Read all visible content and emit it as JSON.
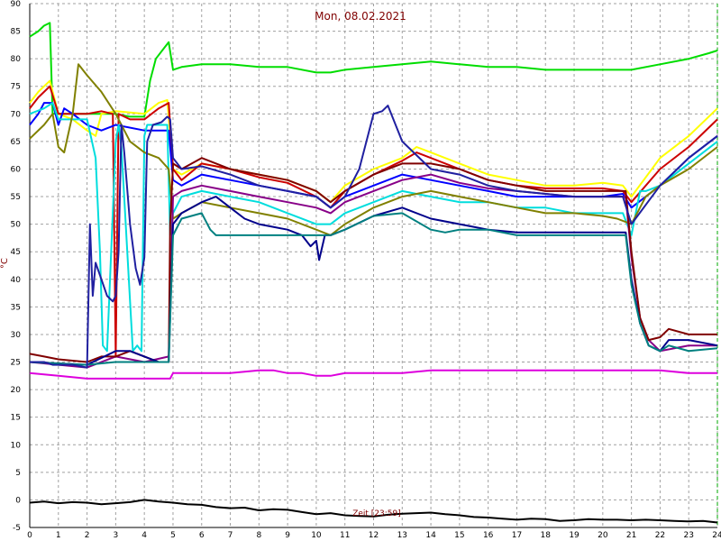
{
  "chart_data": {
    "type": "line",
    "title": "Mon, 08.02.2021",
    "xlabel": "Zeit [23:59]",
    "ylabel": "°C",
    "xlim": [
      0,
      24
    ],
    "ylim": [
      -5,
      90
    ],
    "x_ticks": [
      "0",
      "1",
      "2",
      "3",
      "4",
      "5",
      "6",
      "7",
      "8",
      "9",
      "10",
      "11",
      "12",
      "13",
      "14",
      "15",
      "16",
      "17",
      "18",
      "19",
      "20",
      "21",
      "22",
      "23",
      "24"
    ],
    "y_ticks": [
      "-5",
      "0",
      "5",
      "10",
      "15",
      "20",
      "25",
      "30",
      "35",
      "40",
      "45",
      "50",
      "55",
      "60",
      "65",
      "70",
      "75",
      "80",
      "85",
      "90"
    ],
    "grid": true,
    "series": [
      {
        "color": "#00dd00",
        "x": [
          0,
          0.3,
          0.5,
          0.7,
          0.8,
          1.0,
          1.3,
          1.5,
          2,
          2.5,
          3,
          3.5,
          4,
          4.2,
          4.4,
          4.7,
          4.85,
          5.0,
          5.3,
          6,
          7,
          8,
          9,
          10,
          10.5,
          11,
          12,
          13,
          14,
          15,
          16,
          17,
          18,
          19,
          20,
          21,
          22,
          23,
          23.7,
          24
        ],
        "y": [
          84,
          85,
          86,
          86.5,
          70,
          70,
          70,
          70,
          70,
          70,
          70,
          69.5,
          69.5,
          76,
          80,
          82,
          83,
          78,
          78.5,
          79,
          79,
          78.5,
          78.5,
          77.5,
          77.5,
          78,
          78.5,
          79,
          79.5,
          79,
          78.5,
          78.5,
          78,
          78,
          78,
          78,
          79,
          80,
          81,
          81.5
        ]
      },
      {
        "color": "#ffff00",
        "x": [
          0,
          0.3,
          0.5,
          0.7,
          1.0,
          1.5,
          2,
          2.3,
          2.5,
          3,
          4,
          4.5,
          4.8,
          5,
          5.3,
          6,
          7,
          8,
          9,
          10,
          10.5,
          11,
          12,
          13,
          13.5,
          14,
          15,
          16,
          17,
          18,
          19,
          20,
          20.7,
          21,
          22,
          23,
          24
        ],
        "y": [
          72,
          74,
          75,
          76,
          70,
          69,
          67,
          66,
          70,
          70.5,
          70,
          72,
          72.5,
          60,
          59,
          61,
          60,
          59,
          58,
          56,
          54,
          57,
          60,
          62,
          64,
          63,
          61,
          59,
          58,
          57,
          57,
          57.5,
          57,
          55,
          62,
          66,
          71
        ]
      },
      {
        "color": "#cc0000",
        "x": [
          0,
          0.3,
          0.5,
          0.7,
          1,
          2,
          2.5,
          2.9,
          3,
          3.1,
          3.5,
          4,
          4.5,
          4.85,
          5,
          5.3,
          6,
          7,
          8,
          9,
          10,
          10.5,
          11,
          12,
          13,
          13.5,
          14,
          15,
          16,
          17,
          18,
          19,
          20,
          20.7,
          21,
          22,
          23,
          24
        ],
        "y": [
          71,
          73,
          74,
          75,
          70,
          70,
          70.5,
          70,
          26,
          70,
          69,
          69,
          71,
          72,
          60,
          58,
          61,
          60,
          58.5,
          57.5,
          55,
          53,
          56,
          59,
          61.5,
          63,
          62,
          60,
          58,
          57,
          56.5,
          56.5,
          56.5,
          56,
          54,
          60,
          64,
          69
        ]
      },
      {
        "color": "#0000ff",
        "x": [
          0,
          0.3,
          0.5,
          0.8,
          1.0,
          1.2,
          1.5,
          2,
          2.5,
          3,
          4,
          4.5,
          4.85,
          5,
          5.3,
          6,
          7,
          8,
          9,
          10,
          10.5,
          11,
          12,
          13,
          14,
          15,
          16,
          17,
          18,
          19,
          20,
          20.7,
          21,
          22,
          23,
          24
        ],
        "y": [
          68,
          70,
          72,
          72,
          68,
          71,
          70,
          68,
          67,
          68,
          67,
          67,
          67,
          58,
          57,
          59,
          58,
          57,
          56,
          55,
          53,
          55,
          57,
          59,
          58,
          57,
          56,
          55,
          55,
          55,
          55,
          55.5,
          53,
          57,
          62,
          66
        ]
      },
      {
        "color": "#00dddd",
        "x": [
          0,
          0.5,
          0.8,
          1,
          1.5,
          2,
          2.3,
          2.45,
          2.55,
          2.7,
          3.0,
          3.1,
          3.2,
          3.6,
          3.75,
          3.9,
          4.0,
          4.1,
          4.3,
          4.8,
          4.9,
          5.0,
          5.3,
          6,
          7,
          8,
          9,
          10,
          10.5,
          11,
          12,
          13,
          14,
          15,
          16,
          17,
          18,
          19,
          20,
          20.7,
          21,
          21.3,
          21.5,
          22,
          23,
          24
        ],
        "y": [
          70,
          71,
          72,
          69,
          69,
          69,
          62,
          45,
          28,
          27,
          65,
          68,
          64,
          27,
          28,
          27,
          66,
          68,
          68,
          68,
          48,
          52,
          55,
          56,
          55,
          54,
          52,
          50,
          50,
          52,
          54,
          56,
          55,
          54,
          54,
          53,
          53,
          52,
          52,
          52,
          48,
          56,
          56,
          57,
          61,
          65
        ]
      },
      {
        "color": "#808000",
        "x": [
          0,
          0.5,
          0.8,
          1,
          1.2,
          1.5,
          1.7,
          2,
          2.5,
          3,
          3.5,
          4,
          4.5,
          4.85,
          5,
          5.3,
          6,
          7,
          8,
          9,
          10,
          10.5,
          11,
          12,
          13,
          14,
          15,
          16,
          17,
          18,
          19,
          20,
          20.5,
          21,
          21.5,
          22,
          23,
          24
        ],
        "y": [
          65.5,
          68,
          70,
          64,
          63,
          70,
          79,
          77,
          74,
          70,
          65,
          63,
          62,
          60,
          51,
          52,
          54,
          53,
          52,
          51,
          49,
          48,
          50,
          53,
          55,
          56,
          55,
          54,
          53,
          52,
          52,
          51.5,
          51,
          50,
          55,
          57,
          60,
          64
        ]
      },
      {
        "color": "#880088",
        "x": [
          0,
          2,
          3,
          4,
          4.85,
          5,
          5.3,
          6,
          7,
          8,
          9,
          10,
          10.5,
          11,
          12,
          13,
          14,
          15,
          16,
          17,
          18,
          19,
          20,
          20.8,
          21,
          21.3,
          21.6,
          22,
          23,
          24
        ],
        "y": [
          25,
          24,
          26,
          25,
          26,
          55,
          56,
          57,
          56,
          55,
          54,
          53,
          52,
          54,
          56,
          58,
          59,
          57.5,
          56.5,
          56,
          55.5,
          55,
          55,
          55,
          44,
          33,
          29,
          27,
          28,
          28
        ]
      },
      {
        "color": "#800000",
        "x": [
          0,
          0.5,
          1,
          2,
          2.5,
          3,
          3.5,
          4,
          4.5,
          4.85,
          4.9,
          5.0,
          5.3,
          6,
          7,
          8,
          9,
          10,
          10.5,
          11,
          12,
          13,
          14,
          15,
          16,
          17,
          18,
          19,
          20,
          20.8,
          21,
          21.3,
          21.6,
          22,
          22.3,
          23,
          24
        ],
        "y": [
          26.5,
          26,
          25.5,
          25,
          26,
          26,
          27,
          26,
          25,
          25,
          50,
          61,
          60,
          62,
          60,
          59,
          58,
          56,
          54,
          56,
          59,
          61,
          61,
          60,
          58,
          57,
          56,
          56,
          56,
          56,
          45,
          33,
          29,
          29.5,
          31,
          30,
          30
        ]
      },
      {
        "color": "#00008b",
        "x": [
          0,
          2,
          3,
          3.5,
          4,
          4.5,
          4.85,
          5,
          5.3,
          6,
          6.5,
          7,
          7.5,
          8,
          9,
          9.5,
          9.8,
          10,
          10.1,
          10.3,
          10.5,
          11,
          12,
          13,
          14,
          15,
          16,
          17,
          18,
          19,
          20,
          20.8,
          21,
          21.3,
          21.6,
          22,
          22.3,
          23,
          24
        ],
        "y": [
          25,
          24.5,
          27,
          27,
          26,
          25,
          25,
          50,
          52,
          54,
          55,
          53,
          51,
          50,
          49,
          48,
          46,
          47,
          43.5,
          48,
          48,
          49,
          51.5,
          53,
          51,
          50,
          49,
          48.5,
          48.5,
          48.5,
          48.5,
          48.5,
          40,
          32,
          28,
          27,
          29,
          29,
          28
        ]
      },
      {
        "color": "#008080",
        "x": [
          0,
          2,
          3,
          4,
          4.85,
          5,
          5.3,
          6,
          6.3,
          6.5,
          7,
          8,
          9,
          10,
          10.5,
          11,
          12,
          13,
          14,
          14.5,
          15,
          16,
          17,
          18,
          19,
          20,
          20.8,
          21,
          21.3,
          21.6,
          22,
          22.3,
          23,
          24
        ],
        "y": [
          25,
          24.5,
          25,
          25,
          25,
          48,
          51,
          52,
          49,
          48,
          48,
          48,
          48,
          48,
          48,
          49,
          51.5,
          52,
          49,
          48.5,
          49,
          49,
          48,
          48,
          48,
          48,
          48,
          39,
          32,
          28,
          27,
          28,
          27,
          27.5
        ]
      },
      {
        "color": "#2020a0",
        "x": [
          0,
          0.5,
          0.8,
          1.0,
          1.2,
          1.5,
          2,
          2.1,
          2.2,
          2.3,
          2.5,
          2.7,
          2.9,
          3,
          3.1,
          3.2,
          3.3,
          3.5,
          3.7,
          3.85,
          4.0,
          4.1,
          4.3,
          4.6,
          4.8,
          4.9,
          5.0,
          5.3,
          6,
          7,
          8,
          9,
          10,
          10.5,
          11,
          11.5,
          12,
          12.3,
          12.5,
          13,
          14,
          15,
          16,
          17,
          18,
          19,
          20,
          20.7,
          21,
          22,
          23,
          24
        ],
        "y": [
          25,
          25,
          24.5,
          24.5,
          24.5,
          24.5,
          24,
          50,
          37,
          43,
          40,
          37,
          36,
          37,
          45,
          68,
          63,
          50,
          42,
          39,
          44,
          65,
          68,
          68.5,
          69.5,
          69,
          62,
          60,
          60.5,
          59,
          57,
          56,
          55,
          53,
          55,
          60,
          70,
          70.5,
          71.5,
          65,
          60,
          59,
          57,
          56,
          55.5,
          55,
          55,
          55,
          50,
          57,
          62,
          66
        ]
      },
      {
        "color": "#dd00dd",
        "x": [
          0,
          1,
          2,
          3,
          4,
          4.9,
          5.0,
          6,
          7,
          8,
          8.5,
          9,
          9.5,
          10,
          10.5,
          11,
          12,
          13,
          14,
          15,
          16,
          17,
          18,
          19,
          20,
          21,
          22,
          23,
          24
        ],
        "y": [
          23,
          22.5,
          22,
          22,
          22,
          22,
          23,
          23,
          23,
          23.5,
          23.5,
          23,
          23,
          22.5,
          22.5,
          23,
          23,
          23,
          23.5,
          23.5,
          23.5,
          23.5,
          23.5,
          23.5,
          23.5,
          23.5,
          23.5,
          23,
          23
        ]
      },
      {
        "color": "#000000",
        "x": [
          0,
          0.5,
          1,
          1.5,
          2,
          2.5,
          3,
          3.5,
          4,
          4.5,
          5,
          5.5,
          6,
          6.5,
          7,
          7.5,
          8,
          8.5,
          9,
          9.5,
          10,
          10.5,
          11,
          11.5,
          12,
          12.5,
          13,
          13.5,
          14,
          14.5,
          15,
          15.5,
          16,
          16.5,
          17,
          17.5,
          18,
          18.5,
          19,
          19.5,
          20,
          20.5,
          21,
          21.5,
          22,
          22.5,
          23,
          23.5,
          24
        ],
        "y": [
          -0.5,
          -0.3,
          -0.6,
          -0.4,
          -0.5,
          -0.8,
          -0.6,
          -0.4,
          0.0,
          -0.3,
          -0.5,
          -0.8,
          -0.9,
          -1.3,
          -1.5,
          -1.4,
          -1.9,
          -1.7,
          -1.8,
          -2.2,
          -2.6,
          -2.4,
          -2.8,
          -2.9,
          -3.0,
          -2.7,
          -2.5,
          -2.4,
          -2.3,
          -2.6,
          -2.8,
          -3.1,
          -3.2,
          -3.4,
          -3.6,
          -3.4,
          -3.5,
          -3.8,
          -3.7,
          -3.5,
          -3.6,
          -3.6,
          -3.7,
          -3.6,
          -3.7,
          -3.8,
          -3.9,
          -3.8,
          -4.1
        ]
      }
    ]
  }
}
